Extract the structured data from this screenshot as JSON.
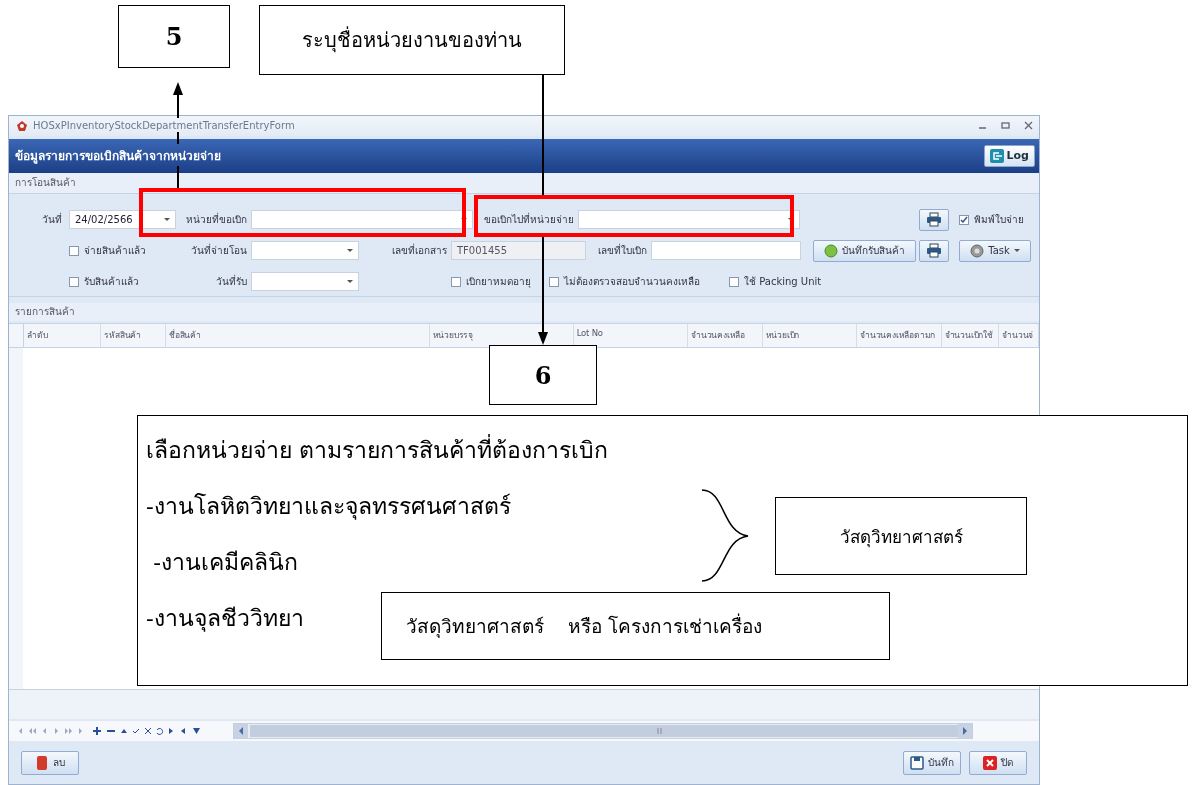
{
  "window": {
    "title": "HOSxPInventoryStockDepartmentTransferEntryForm"
  },
  "header": {
    "title": "ข้อมูลรายการขอเบิกสินค้าจากหน่วยจ่าย",
    "log_button": "Log"
  },
  "transfer_group": {
    "label": "การโอนสินค้า",
    "items": [
      {
        "kind": "label",
        "text": "วันที่"
      },
      {
        "kind": "combo",
        "value": "24/02/2566"
      },
      {
        "kind": "label",
        "text": "หน่วยที่ขอเบิก"
      },
      {
        "kind": "combo"
      },
      {
        "kind": "label",
        "text": "ขอเบิกไปที่หน่วยจ่าย"
      },
      {
        "kind": "combo"
      },
      {
        "kind": "print"
      },
      {
        "kind": "checkbox",
        "label": "พิมพ์ใบจ่าย",
        "checked": true
      },
      {
        "kind": "checkbox",
        "label": "จ่ายสินค้าแล้ว",
        "checked": false
      },
      {
        "kind": "label",
        "text": "วันที่จ่ายโอน"
      },
      {
        "kind": "combo"
      },
      {
        "kind": "label",
        "text": "เลขที่เอกสาร"
      },
      {
        "kind": "field",
        "value": "TF001455",
        "disabled": true
      },
      {
        "kind": "label",
        "text": "เลขที่ใบเบิก"
      },
      {
        "kind": "field",
        "disabled": false
      },
      {
        "kind": "receive",
        "label": "บันทึกรับสินค้า"
      },
      {
        "kind": "print"
      },
      {
        "kind": "task",
        "label": "Task"
      },
      {
        "kind": "checkbox",
        "label": "รับสินค้าแล้ว",
        "checked": false
      },
      {
        "kind": "label",
        "text": "วันที่รับ"
      },
      {
        "kind": "combo"
      },
      {
        "kind": "checkbox",
        "label": "เบิกยาหมดอายุ",
        "checked": false
      },
      {
        "kind": "checkbox",
        "label": "ไม่ต้องตรวจสอบจำนวนคงเหลือ",
        "checked": false
      },
      {
        "kind": "checkbox",
        "label": "ใช้ Packing Unit",
        "checked": false
      }
    ]
  },
  "items_group": {
    "label": "รายการสินค้า",
    "columns": [
      "ลำดับ",
      "รหัสสินค้า",
      "ชื่อสินค้า",
      "หน่วยบรรจุ",
      "Lot No",
      "จำนวนคงเหลือ",
      "หน่วยเบิก",
      "จำนวนคงเหลือตามก",
      "จำนวนเบิกใช้",
      "จำนวนจ่"
    ]
  },
  "footer": {
    "buttons": [
      {
        "kind": "delete",
        "label": "ลบ"
      },
      {
        "kind": "save",
        "label": "บันทึก"
      },
      {
        "kind": "close",
        "label": "ปิด"
      }
    ]
  },
  "annotations": {
    "step_5": "5",
    "note_5": "ระบุชื่อหน่วยงานของท่าน",
    "step_6": "6",
    "instructions": [
      "เลือกหน่วยจ่าย ตามรายการสินค้าที่ต้องการเบิก",
      "-งานโลหิตวิทยาและจุลทรรศนศาสตร์",
      " -งานเคมีคลินิก",
      "-งานจุลชีววิทยา"
    ],
    "brace_label": "วัสดุวิทยาศาสตร์",
    "line_label": "วัสดุวิทยาศาสตร์    หรือ โครงการเช่าเครื่อง"
  }
}
